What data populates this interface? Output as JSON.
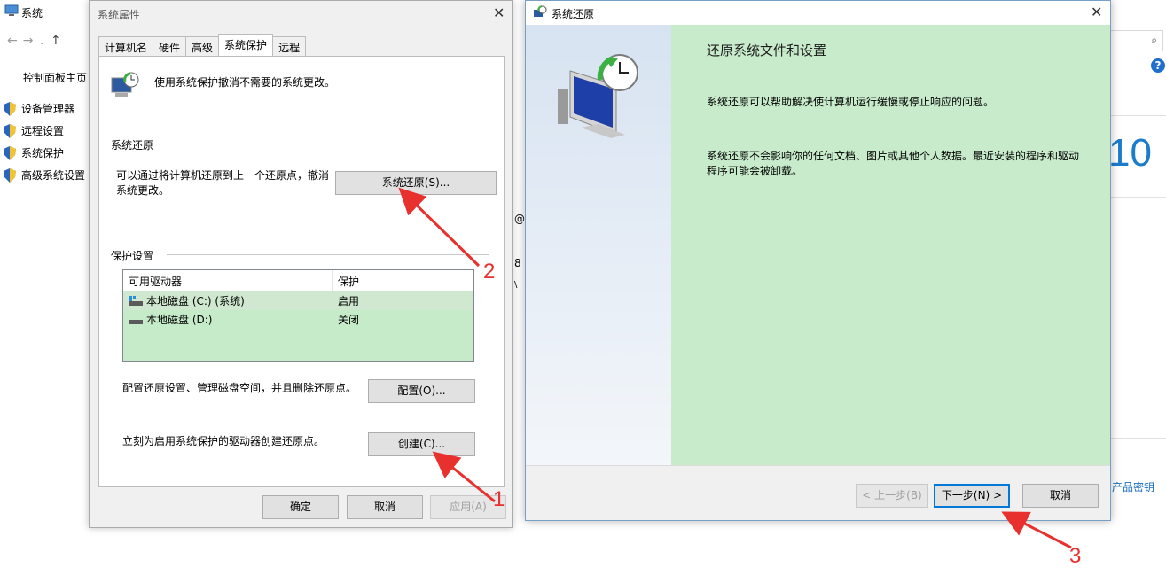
{
  "background": {
    "title": "系统",
    "sidebar": [
      {
        "label": "控制面板主页",
        "icon": "none"
      },
      {
        "label": "设备管理器",
        "icon": "shield-icon"
      },
      {
        "label": "远程设置",
        "icon": "shield-icon"
      },
      {
        "label": "系统保护",
        "icon": "shield-icon"
      },
      {
        "label": "高级系统设置",
        "icon": "shield-icon"
      }
    ],
    "windows_logo_text": "10",
    "product_key_link": "产品密钥",
    "help_icon": "?",
    "fragments": [
      "@",
      "8",
      "\\"
    ]
  },
  "sysprop": {
    "title": "系统属性",
    "tabs": [
      "计算机名",
      "硬件",
      "高级",
      "系统保护",
      "远程"
    ],
    "active_tab": "系统保护",
    "description": "使用系统保护撤消不需要的系统更改。",
    "restore_group": "系统还原",
    "restore_text": "可以通过将计算机还原到上一个还原点，撤消系统更改。",
    "restore_button": "系统还原(S)...",
    "protection_group": "保护设置",
    "table": {
      "headers": [
        "可用驱动器",
        "保护"
      ],
      "rows": [
        {
          "drive": "本地磁盘 (C:) (系统)",
          "status": "启用"
        },
        {
          "drive": "本地磁盘 (D:)",
          "status": "关闭"
        }
      ]
    },
    "config_text": "配置还原设置、管理磁盘空间，并且删除还原点。",
    "config_button": "配置(O)...",
    "create_text": "立刻为启用系统保护的驱动器创建还原点。",
    "create_button": "创建(C)...",
    "ok_button": "确定",
    "cancel_button": "取消",
    "apply_button": "应用(A)"
  },
  "restore": {
    "title": "系统还原",
    "heading": "还原系统文件和设置",
    "para1": "系统还原可以帮助解决使计算机运行缓慢或停止响应的问题。",
    "para2": "系统还原不会影响你的任何文档、图片或其他个人数据。最近安装的程序和驱动程序可能会被卸载。",
    "back_button": "< 上一步(B)",
    "next_button": "下一步(N) >",
    "cancel_button": "取消"
  },
  "annotations": [
    "1",
    "2",
    "3"
  ],
  "colors": {
    "accent": "#0078d7",
    "annotation": "#e8302f",
    "wizard_bg": "#c8eccb"
  }
}
